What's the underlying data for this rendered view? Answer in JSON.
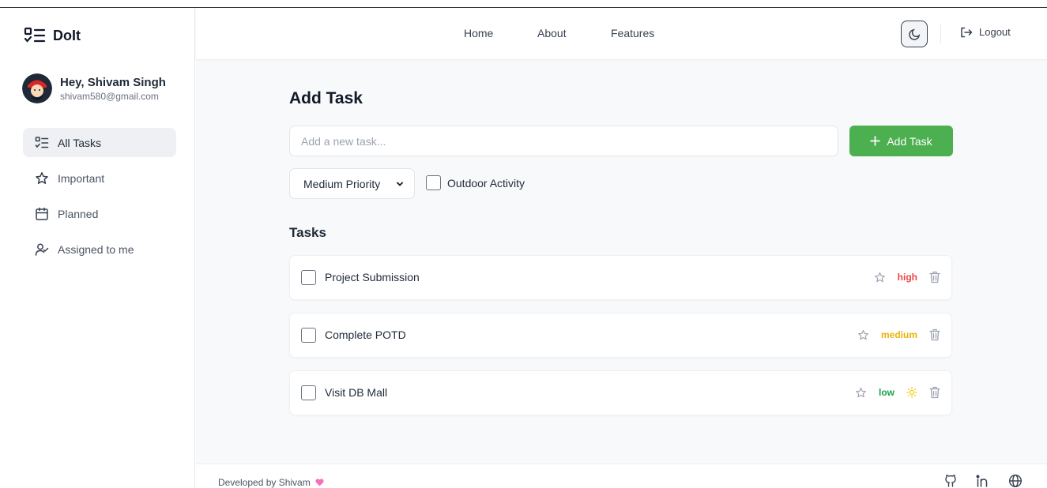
{
  "app": {
    "name": "DoIt"
  },
  "user": {
    "greeting": "Hey, Shivam Singh",
    "email": "shivam580@gmail.com"
  },
  "sidebar": {
    "items": [
      {
        "label": "All Tasks",
        "icon": "list-icon",
        "active": true
      },
      {
        "label": "Important",
        "icon": "star-icon",
        "active": false
      },
      {
        "label": "Planned",
        "icon": "calendar-icon",
        "active": false
      },
      {
        "label": "Assigned to me",
        "icon": "user-icon",
        "active": false
      }
    ]
  },
  "header": {
    "links": [
      "Home",
      "About",
      "Features"
    ],
    "theme_icon": "moon-icon",
    "logout_label": "Logout"
  },
  "add_task": {
    "heading": "Add Task",
    "placeholder": "Add a new task...",
    "button_label": "Add Task",
    "priority_selected": "Medium Priority",
    "outdoor_label": "Outdoor Activity"
  },
  "tasks_heading": "Tasks",
  "tasks": [
    {
      "title": "Project Submission",
      "priority": "high",
      "priority_color": "#ef4444",
      "outdoor": false
    },
    {
      "title": "Complete POTD",
      "priority": "medium",
      "priority_color": "#eab308",
      "outdoor": false
    },
    {
      "title": "Visit DB Mall",
      "priority": "low",
      "priority_color": "#16a34a",
      "outdoor": true
    }
  ],
  "footer": {
    "credit": "Developed by Shivam",
    "heart_color": "#f472b6",
    "social_icons": [
      "github-icon",
      "linkedin-icon",
      "globe-icon"
    ]
  },
  "colors": {
    "accent": "#4caf50",
    "main_bg": "#f8f9fb"
  }
}
